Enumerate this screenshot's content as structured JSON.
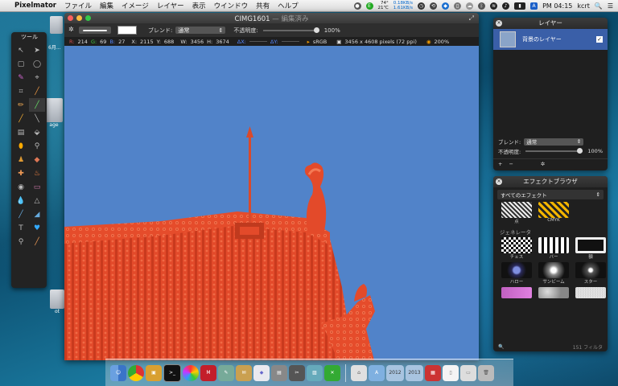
{
  "menubar": {
    "app_name": "Pixelmator",
    "items": [
      "ファイル",
      "編集",
      "イメージ",
      "レイヤー",
      "表示",
      "ウインドウ",
      "共有",
      "ヘルプ"
    ],
    "weather_temp": "74°",
    "weather_sub": "21℃",
    "net_up": "0.18KB/s",
    "net_down": "1.61KB/s",
    "clock": "PM 04:15",
    "user": "kcrt"
  },
  "window": {
    "title": "CIMG1601",
    "status": "— 編集済み",
    "blend_label": "ブレンド:",
    "blend_value": "通常",
    "opacity_label": "不透明度:",
    "opacity_value": "100%",
    "info": {
      "r_label": "R:",
      "r": "214",
      "g_label": "G:",
      "g": "69",
      "b_label": "B:",
      "b": "27",
      "x_label": "X:",
      "x": "2115",
      "y_label": "Y:",
      "y": "688",
      "w_label": "W:",
      "w": "3456",
      "h_label": "H:",
      "h": "3674",
      "dx_label": "ΔX:",
      "dy_label": "ΔY:",
      "color_profile": "sRGB",
      "size": "3456 x 4608 pixels (72 ppi)",
      "zoom": "200%"
    }
  },
  "tools": {
    "title": "ツール",
    "icons": [
      "move-icon",
      "pointer-icon",
      "rect-select-icon",
      "ellipse-select-icon",
      "lasso-icon",
      "polygon-lasso-icon",
      "crop-icon",
      "eyedropper-icon",
      "pencil-icon",
      "brush-icon",
      "smudge-icon",
      "line-icon",
      "gradient-icon",
      "bucket-icon",
      "sponge-icon",
      "dodge-icon",
      "stamp-icon",
      "eraser-icon",
      "heal-icon",
      "burn-icon",
      "eye-icon",
      "blur-icon",
      "droplet-icon",
      "sharpen-icon",
      "pen-icon",
      "vector-icon",
      "type-icon",
      "shape-icon",
      "zoom-icon",
      "hand-icon"
    ]
  },
  "layers": {
    "title": "レイヤー",
    "layer_name": "背景のレイヤー",
    "blend_label": "ブレンド:",
    "blend_value": "通常",
    "opacity_label": "不透明度:",
    "opacity_value": "100%",
    "add": "+",
    "remove": "−"
  },
  "effects": {
    "title": "エフェクトブラウザ",
    "filter_select": "すべてのエフェクト",
    "top_row": [
      {
        "label": "点"
      },
      {
        "label": "CMYK"
      }
    ],
    "category": "ジェネレータ",
    "gen_row1": [
      {
        "label": "チェス"
      },
      {
        "label": "バー"
      },
      {
        "label": "額"
      }
    ],
    "gen_row2": [
      {
        "label": "ハロー"
      },
      {
        "label": "サンビーム"
      },
      {
        "label": "スター"
      }
    ],
    "count": "151 フィルタ"
  },
  "desktop_icons": [
    {
      "label": "6月..."
    },
    {
      "label": "age"
    },
    {
      "label": "ot"
    }
  ],
  "dock": {
    "folder_2012": "2012",
    "folder_2013": "2013"
  },
  "colors": {
    "sky": "#5183c9",
    "roof": "#e34a2a",
    "selection": "#3a5fa8"
  }
}
